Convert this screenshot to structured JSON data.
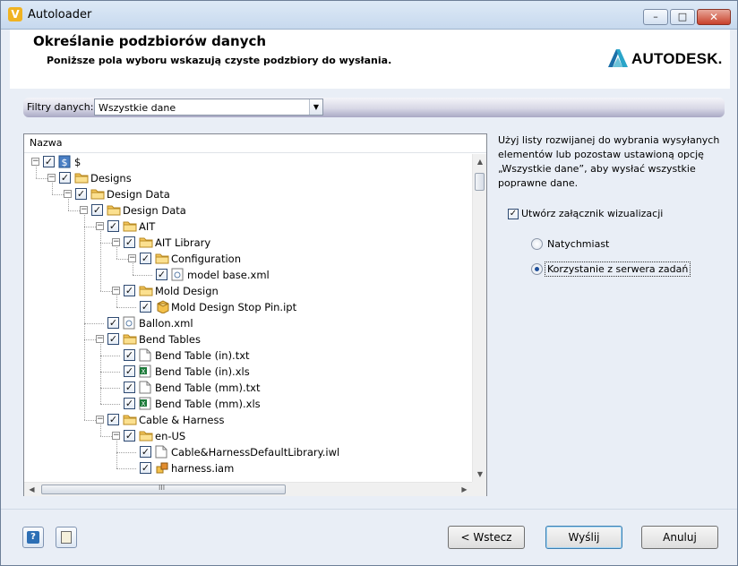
{
  "window": {
    "title": "Autoloader",
    "icon": "autoloader-v-icon",
    "controls": {
      "minimize": "–",
      "maximize": "□",
      "close": "✕"
    }
  },
  "header": {
    "title": "Określanie podzbiorów danych",
    "subtitle": "Poniższe pola wyboru wskazują czyste podzbiory do wysłania.",
    "logo": "AUTODESK."
  },
  "filter": {
    "label": "Filtry danych:",
    "value": "Wszystkie dane"
  },
  "tree": {
    "column": "Nazwa",
    "items": [
      {
        "label": "$",
        "icon": "vault-root-icon",
        "level": 0
      },
      {
        "label": "Designs",
        "icon": "folder-icon",
        "level": 1
      },
      {
        "label": "Design Data",
        "icon": "folder-icon",
        "level": 2
      },
      {
        "label": "Design Data",
        "icon": "folder-icon",
        "level": 3
      },
      {
        "label": "AIT",
        "icon": "folder-icon",
        "level": 4
      },
      {
        "label": "AIT Library",
        "icon": "folder-icon",
        "level": 5
      },
      {
        "label": "Configuration",
        "icon": "folder-icon",
        "level": 6
      },
      {
        "label": "model base.xml",
        "icon": "xml-file-icon",
        "level": 7
      },
      {
        "label": "Mold Design",
        "icon": "folder-icon",
        "level": 5
      },
      {
        "label": "Mold Design Stop Pin.ipt",
        "icon": "inventor-part-icon",
        "level": 6
      },
      {
        "label": "Ballon.xml",
        "icon": "xml-file-icon",
        "level": 4
      },
      {
        "label": "Bend Tables",
        "icon": "folder-icon",
        "level": 4
      },
      {
        "label": "Bend Table (in).txt",
        "icon": "text-file-icon",
        "level": 5
      },
      {
        "label": "Bend Table (in).xls",
        "icon": "excel-file-icon",
        "level": 5
      },
      {
        "label": "Bend Table (mm).txt",
        "icon": "text-file-icon",
        "level": 5
      },
      {
        "label": "Bend Table (mm).xls",
        "icon": "excel-file-icon",
        "level": 5
      },
      {
        "label": "Cable & Harness",
        "icon": "folder-icon",
        "level": 4
      },
      {
        "label": "en-US",
        "icon": "folder-icon",
        "level": 5
      },
      {
        "label": "Cable&HarnessDefaultLibrary.iwl",
        "icon": "text-file-icon",
        "level": 6
      },
      {
        "label": "harness.iam",
        "icon": "inventor-assembly-icon",
        "level": 6
      }
    ]
  },
  "options": {
    "help": "Użyj listy rozwijanej do wybrania wysyłanych elementów lub pozostaw ustawioną opcję „Wszystkie dane”, aby wysłać wszystkie poprawne dane.",
    "attach_label": "Utwórz załącznik wizualizacji",
    "attach_checked": true,
    "radio_now": "Natychmiast",
    "radio_server": "Korzystanie z serwera zadań",
    "radio_selected": "server"
  },
  "footer": {
    "back": "< Wstecz",
    "send": "Wyślij",
    "cancel": "Anuluj"
  },
  "colors": {
    "accent": "#3c7fb1",
    "folder": "#f3c55a",
    "window_bg": "#e9eef6"
  }
}
